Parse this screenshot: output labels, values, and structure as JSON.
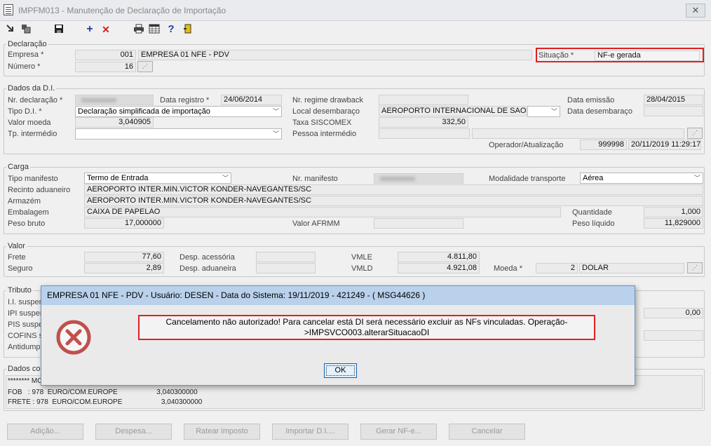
{
  "window": {
    "title": "IMPFM013 - Manutenção de Declaração de Importação",
    "close_glyph": "✕"
  },
  "toolbar": {
    "icons": [
      "first-record-icon",
      "copy-icon",
      "save-icon",
      "add-icon",
      "delete-icon",
      "print-icon",
      "grid-icon",
      "help-icon",
      "exit-icon"
    ]
  },
  "declaracao": {
    "title": "Declaração",
    "empresa_label": "Empresa *",
    "empresa_code": "001",
    "empresa_name": "EMPRESA 01 NFE - PDV",
    "numero_label": "Número *",
    "numero_value": "16",
    "situacao_label": "Situação *",
    "situacao_value": "NF-e gerada"
  },
  "dados_di": {
    "title": "Dados da D.I.",
    "nr_declaracao_label": "Nr. declaração *",
    "data_registro_label": "Data registro *",
    "data_registro_value": "24/06/2014",
    "nr_regime_label": "Nr. regime drawback",
    "data_emissao_label": "Data emissão",
    "data_emissao_value": "28/04/2015",
    "tipo_di_label": "Tipo D.I. *",
    "tipo_di_value": "Declaração simplificada de importação",
    "local_desembaraco_label": "Local desembaraço",
    "local_desembaraco_value": "AEROPORTO INTERNACIONAL DE SAO PA",
    "data_desembaraco_label": "Data desembaraço",
    "valor_moeda_label": "Valor moeda",
    "valor_moeda_value": "3,040905",
    "taxa_siscomex_label": "Taxa SISCOMEX",
    "taxa_siscomex_value": "332,50",
    "tp_intermedio_label": "Tp. intermédio",
    "pessoa_intermedio_label": "Pessoa intermédio",
    "operador_label": "Operador/Atualização",
    "operador_code": "999998",
    "operador_date": "20/11/2019 11:29:17"
  },
  "carga": {
    "title": "Carga",
    "tipo_manifesto_label": "Tipo manifesto",
    "tipo_manifesto_value": "Termo de Entrada",
    "nr_manifesto_label": "Nr. manifesto",
    "modalidade_label": "Modalidade transporte",
    "modalidade_value": "Aérea",
    "recinto_label": "Recinto aduaneiro",
    "recinto_value": "AEROPORTO INTER.MIN.VICTOR KONDER-NAVEGANTES/SC",
    "armazem_label": "Armazém",
    "armazem_value": "AEROPORTO INTER.MIN.VICTOR KONDER-NAVEGANTES/SC",
    "embalagem_label": "Embalagem",
    "embalagem_value": "CAIXA DE PAPELAO",
    "quantidade_label": "Quantidade",
    "quantidade_value": "1,000",
    "peso_bruto_label": "Peso bruto",
    "peso_bruto_value": "17,000000",
    "valor_afrmm_label": "Valor AFRMM",
    "peso_liquido_label": "Peso líquido",
    "peso_liquido_value": "11,829000"
  },
  "valor": {
    "title": "Valor",
    "frete_label": "Frete",
    "frete_value": "77,60",
    "desp_acessoria_label": "Desp. acessória",
    "vmle_label": "VMLE",
    "vmle_value": "4.811,80",
    "seguro_label": "Seguro",
    "seguro_value": "2,89",
    "desp_aduaneira_label": "Desp. aduaneira",
    "vmld_label": "VMLD",
    "vmld_value": "4.921,08",
    "moeda_label": "Moeda *",
    "moeda_code": "2",
    "moeda_name": "DOLAR"
  },
  "tributo": {
    "title": "Tributo",
    "labels": [
      "I.I. suspen",
      "IPI suspen",
      "PIS suspe",
      "COFINS su",
      "Antidumpi"
    ],
    "value_right": "0,00"
  },
  "dados_complementares": {
    "title": "Dados co",
    "lines": [
      "******** MC",
      "FOB   : 978  EURO/COM.EUROPE                    3,040300000",
      "FRETE : 978  EURO/COM.EUROPE                    3,040300000"
    ]
  },
  "buttons": [
    "Adição...",
    "Despesa...",
    "Ratear imposto",
    "Importar D.I....",
    "Gerar NF-e...",
    "Cancelar"
  ],
  "dialog": {
    "title": "EMPRESA 01 NFE - PDV - Usuário: DESEN - Data do Sistema: 19/11/2019 - 421249 - ( MSG44626 )",
    "message_line1": "Cancelamento não autorizado! Para cancelar está DI será necessário excluir as NFs vinculadas. Operação-",
    "message_line2": ">IMPSVCO003.alterarSituacaoDI",
    "ok_label": "OK"
  },
  "colors": {
    "dialog_title_bg": "#b9d1ea",
    "highlight_red": "#e02020",
    "error_icon": "#c0504d"
  }
}
